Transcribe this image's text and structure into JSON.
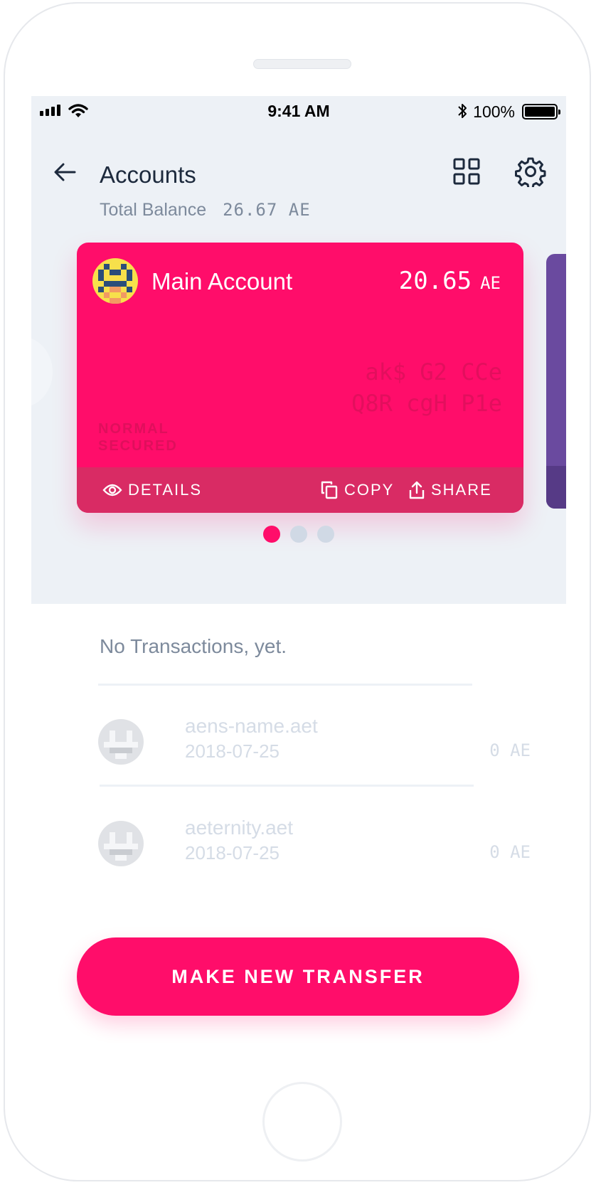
{
  "status_bar": {
    "time": "9:41 AM",
    "battery": "100%"
  },
  "header": {
    "title": "Accounts",
    "balance_label": "Total Balance",
    "balance_value": "26.67 AE"
  },
  "card": {
    "name": "Main Account",
    "balance": "20.65",
    "unit": "AE",
    "address_line1": "ak$ G2 CCe",
    "address_dots": "··· ··· ···",
    "address_line2": "Q8R cgH P1e",
    "security_line1": "NORMAL",
    "security_line2": "SECURED",
    "actions": {
      "details": "DETAILS",
      "copy": "COPY",
      "share": "SHARE"
    },
    "color": "#ff0d6a"
  },
  "pager": {
    "count": 3,
    "active": 0
  },
  "transactions": {
    "empty_text": "No Transactions, yet.",
    "items": [
      {
        "name": "aens-name.aet",
        "date": "2018-07-25",
        "amount": "0 AE"
      },
      {
        "name": "aeternity.aet",
        "date": "2018-07-25",
        "amount": "0 AE"
      }
    ]
  },
  "cta": {
    "label": "MAKE NEW TRANSFER"
  },
  "icons": [
    "back-arrow-icon",
    "grid-icon",
    "gear-icon",
    "eye-icon",
    "copy-icon",
    "share-icon"
  ]
}
